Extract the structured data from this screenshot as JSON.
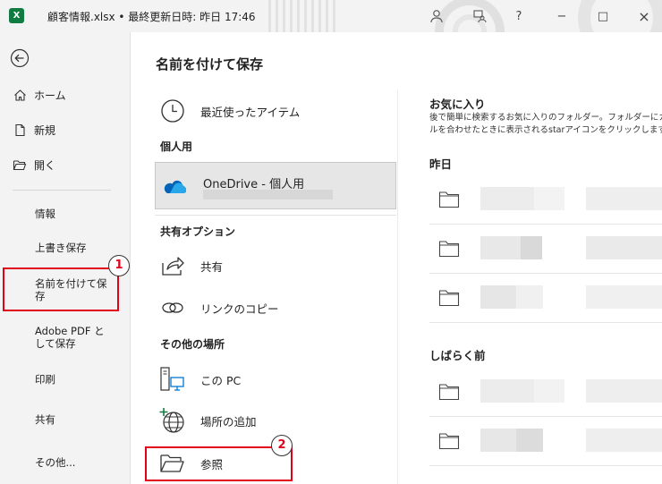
{
  "titlebar": {
    "app_icon_label": "X",
    "document_title": "顧客情報.xlsx • 最終更新日時: 昨日 17:46",
    "buttons": {
      "help": "?",
      "minimize": "−",
      "maximize": "□",
      "close": "×"
    }
  },
  "sidebar": {
    "back_icon": "back-arrow-icon",
    "primary_items": [
      {
        "label": "ホーム",
        "icon": "home-icon"
      },
      {
        "label": "新規",
        "icon": "new-document-icon"
      },
      {
        "label": "開く",
        "icon": "open-folder-icon"
      }
    ],
    "secondary_items": [
      {
        "label": "情報"
      },
      {
        "label": "上書き保存"
      },
      {
        "label": "名前を付けて保存",
        "line1": "名前を付けて保",
        "line2": "存",
        "selected": true
      },
      {
        "label": "Adobe PDF として保存",
        "line1": "Adobe PDF と",
        "line2": "して保存"
      },
      {
        "label": "印刷"
      },
      {
        "label": "共有"
      },
      {
        "label": "その他..."
      }
    ]
  },
  "annotations": {
    "marker1": "1",
    "marker2": "2",
    "highlight_color": "#e0001a"
  },
  "main": {
    "title": "名前を付けて保存",
    "recent": {
      "label": "最近使ったアイテム",
      "icon": "clock-icon"
    },
    "personal_heading": "個人用",
    "onedrive": {
      "label": "OneDrive - 個人用",
      "icon": "onedrive-cloud-icon",
      "selected": true
    },
    "share_heading": "共有オプション",
    "share": {
      "label": "共有",
      "icon": "share-icon"
    },
    "copy_link": {
      "label": "リンクのコピー",
      "icon": "link-icon"
    },
    "other_heading": "その他の場所",
    "this_pc": {
      "label": "この PC",
      "icon": "computer-icon"
    },
    "add_place": {
      "label": "場所の追加",
      "icon": "globe-add-icon"
    },
    "browse": {
      "label": "参照",
      "icon": "folder-open-icon"
    }
  },
  "right_panel": {
    "favorites_title": "お気に入り",
    "favorites_desc_line1": "後で簡単に検索するお気に入りのフォルダー。フォルダーにカーソ",
    "favorites_desc_line2": "ルを合わせたときに表示されるstarアイコンをクリックします。",
    "yesterday_title": "昨日",
    "earlier_title": "しばらく前",
    "yesterday_rows": 3,
    "earlier_rows": 2
  },
  "colors": {
    "excel_green": "#107c41",
    "onedrive_blue": "#0364b8",
    "sidebar_bg": "#f3f3f3"
  }
}
